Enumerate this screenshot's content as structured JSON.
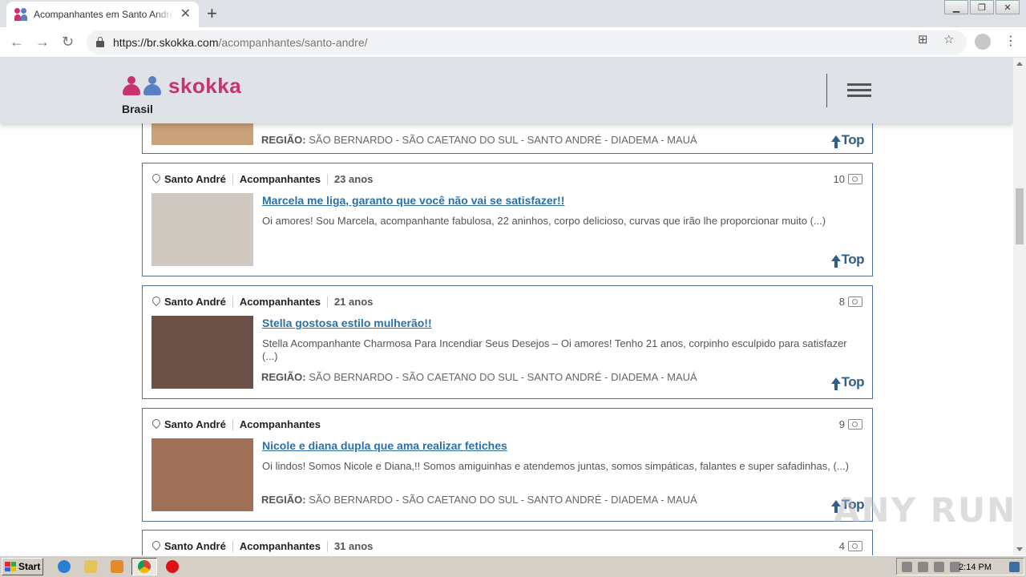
{
  "browser": {
    "tab_title": "Acompanhantes em Santo André e g",
    "url_host": "https://br.skokka.com",
    "url_path": "/acompanhantes/santo-andre/"
  },
  "site": {
    "logo_text": "skokka",
    "country": "Brasil"
  },
  "listings": [
    {
      "partial": true,
      "region_label": "REGIÃO:",
      "region": "SÃO BERNARDO - SÃO CAETANO DO SUL - SANTO ANDRÉ - DIADEMA - MAUÁ",
      "top_label": "Top",
      "thumb_color": "#caa27a"
    },
    {
      "city": "Santo André",
      "category": "Acompanhantes",
      "age": "23 anos",
      "photos": "10",
      "title": "Marcela me liga, garanto que você não vai se satisfazer!!",
      "description": "Oi amores! Sou Marcela, acompanhante fabulosa, 22 aninhos, corpo delicioso, curvas que irão lhe proporcionar muito (...)",
      "region_label": "",
      "region": "",
      "top_label": "Top",
      "thumb_color": "#cfc9c2"
    },
    {
      "city": "Santo André",
      "category": "Acompanhantes",
      "age": "21 anos",
      "photos": "8",
      "title": "Stella gostosa estilo mulherão!!",
      "description": "Stella Acompanhante Charmosa Para Incendiar Seus Desejos – Oi amores! Tenho 21 anos, corpinho esculpido para satisfazer (...)",
      "region_label": "REGIÃO:",
      "region": "SÃO BERNARDO - SÃO CAETANO DO SUL - SANTO ANDRÉ - DIADEMA - MAUÁ",
      "top_label": "Top",
      "thumb_color": "#6b5048"
    },
    {
      "city": "Santo André",
      "category": "Acompanhantes",
      "age": "",
      "photos": "9",
      "title": "Nicole e diana dupla que ama realizar fetiches",
      "description": "Oi lindos! Somos Nicole e Diana,!! Somos amiguinhas e atendemos juntas, somos simpáticas, falantes e super safadinhas, (...)",
      "region_label": "REGIÃO:",
      "region": "SÃO BERNARDO - SÃO CAETANO DO SUL - SANTO ANDRÉ - DIADEMA - MAUÁ",
      "top_label": "Top",
      "thumb_color": "#a07058"
    },
    {
      "city": "Santo André",
      "category": "Acompanhantes",
      "age": "31 anos",
      "photos": "4"
    }
  ],
  "taskbar": {
    "start_label": "Start",
    "clock": "2:14 PM"
  },
  "watermark": "ANY RUN"
}
